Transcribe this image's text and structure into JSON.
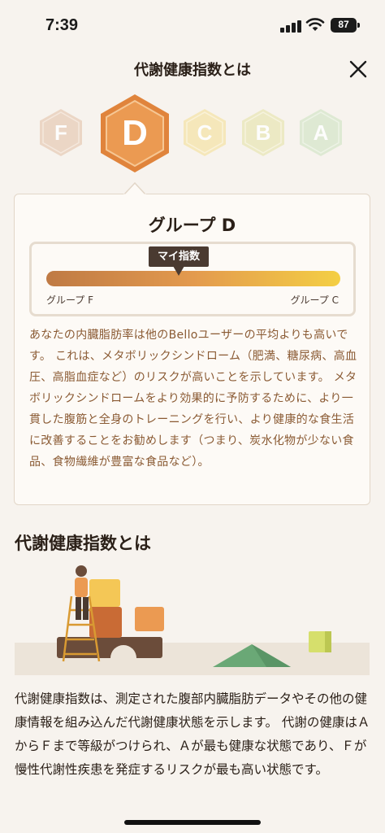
{
  "status_bar": {
    "time": "7:39",
    "battery": "87"
  },
  "header": {
    "title": "代謝健康指数とは",
    "close_icon": "close-icon"
  },
  "grades": {
    "items": [
      {
        "letter": "F",
        "color": "#e7cbb7"
      },
      {
        "letter": "D",
        "color": "#e8924a"
      },
      {
        "letter": "C",
        "color": "#f4e3a8"
      },
      {
        "letter": "B",
        "color": "#e8e6b4"
      },
      {
        "letter": "A",
        "color": "#d8e6cc"
      }
    ],
    "selected": "D"
  },
  "card": {
    "title": "グループ D",
    "gauge": {
      "marker_label": "マイ指数",
      "marker_position": 0.45,
      "left_label": "グループ F",
      "right_label": "グループ C"
    },
    "description": "あなたの内臓脂肪率は他のBelloユーザーの平均よりも高いです。 これは、メタボリックシンドローム（肥満、糖尿病、高血圧、高脂血症など）のリスクが高いことを示しています。 メタボリックシンドロームをより効果的に予防するために、より一貫した腹筋と全身のトレーニングを行い、より健康的な食生活に改善することをお勧めします（つまり、炭水化物が少ない食品、食物繊維が豊富な食品など）。"
  },
  "section": {
    "title": "代謝健康指数とは",
    "body": "代謝健康指数は、測定された腹部内臓脂肪データやその他の健康情報を組み込んだ代謝健康状態を示します。 代謝の健康はＡからＦまで等級がつけられ、Ａが最も健康な状態であり、Ｆが慢性代謝性疾患を発症するリスクが最も高い状態です。"
  },
  "colors": {
    "accent": "#e8924a",
    "text_brown": "#8a5a33",
    "background": "#f7f3ee"
  }
}
